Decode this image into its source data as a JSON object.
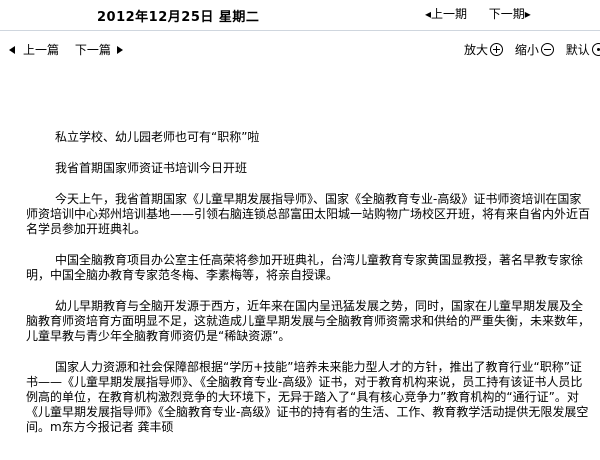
{
  "header": {
    "date": "2012年12月25日  星期二",
    "prev_issue": "上一期",
    "next_issue": "下一期"
  },
  "toolbar": {
    "prev_article": "上一篇",
    "next_article": "下一篇",
    "zoom_in": "放大",
    "zoom_out": "缩小",
    "default": "默认"
  },
  "article": {
    "title": "私立学校、幼儿园老师也可有“职称”啦",
    "subtitle": "我省首期国家师资证书培训今日开班",
    "paragraphs": [
      "今天上午，我省首期国家《儿童早期发展指导师》、国家《全脑教育专业-高级》证书师资培训在国家师资培训中心郑州培训基地——引领右脑连锁总部富田太阳城一站购物广场校区开班，将有来自省内外近百名学员参加开班典礼。",
      "中国全脑教育项目办公室主任高荣将参加开班典礼，台湾儿童教育专家黄国显教授，著名早教专家徐明，中国全脑办教育专家范冬梅、李素梅等，将亲自授课。",
      "幼儿早期教育与全脑开发源于西方，近年来在国内呈迅猛发展之势，同时，国家在儿童早期发展及全脑教育师资培育方面明显不足，这就造成儿童早期发展与全脑教育师资需求和供给的严重失衡，未来数年，儿童早教与青少年全脑教育师资仍是“稀缺资源”。",
      "国家人力资源和社会保障部根据“学历+技能”培养未来能力型人才的方针，推出了教育行业“职称”证书——《儿童早期发展指导师》、《全脑教育专业-高级》证书，对于教育机构来说，员工持有该证书人员比例高的单位，在教育机构激烈竞争的大环境下，无异于踏入了“具有核心竞争力”教育机构的“通行证”。对《儿童早期发展指导师》《全脑教育专业-高级》证书的持有者的生活、工作、教育教学活动提供无限发展空间。m东方今报记者   龚丰硕"
    ]
  }
}
